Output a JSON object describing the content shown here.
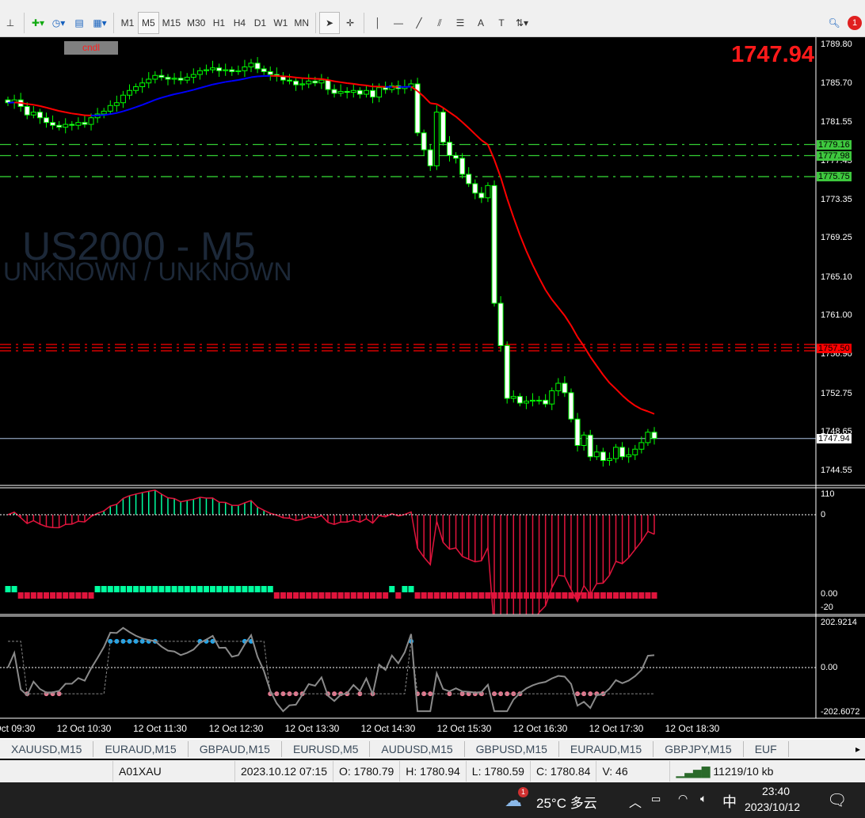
{
  "toolbar": {
    "timeframes": [
      "M1",
      "M5",
      "M15",
      "M30",
      "H1",
      "H4",
      "D1",
      "W1",
      "MN"
    ],
    "active_timeframe": "M5",
    "notification_count": "1"
  },
  "chart": {
    "symbol_watermark": "US2000 - M5",
    "subtitle_watermark": "UNKNOWN / UNKNOWN",
    "indicator_button": "cndl",
    "current_price": "1747.94",
    "colors": {
      "bull": "#00ff00",
      "bear_fill": "#ffffff",
      "ma_up": "#0000ff",
      "ma_down": "#ff0000",
      "level_green": "#32cd32",
      "level_red": "#ff0000"
    },
    "price_axis": [
      "1789.80",
      "1785.70",
      "1781.55",
      "1777.45",
      "1773.35",
      "1769.25",
      "1765.10",
      "1761.00",
      "1756.90",
      "1752.75",
      "1748.65",
      "1744.55"
    ],
    "levels": [
      {
        "price": "1779.16",
        "color": "green"
      },
      {
        "price": "1777.98",
        "color": "green"
      },
      {
        "price": "1775.75",
        "color": "green"
      },
      {
        "price": "1757.50",
        "color": "red"
      },
      {
        "price": "1747.94",
        "color": "white"
      }
    ],
    "time_axis": [
      "12 Oct 09:30",
      "12 Oct 10:30",
      "12 Oct 11:30",
      "12 Oct 12:30",
      "12 Oct 13:30",
      "12 Oct 14:30",
      "12 Oct 15:30",
      "12 Oct 16:30",
      "12 Oct 17:30",
      "12 Oct 18:30"
    ],
    "closes": [
      1783.6,
      1783.9,
      1783.2,
      1782.3,
      1782.6,
      1782.0,
      1781.5,
      1781.2,
      1781.0,
      1781.3,
      1781.2,
      1781.5,
      1781.3,
      1782.0,
      1782.4,
      1782.7,
      1783.3,
      1783.6,
      1784.4,
      1784.9,
      1785.3,
      1785.7,
      1786.1,
      1786.5,
      1786.3,
      1786.1,
      1786.2,
      1786.0,
      1786.3,
      1786.6,
      1787.0,
      1787.1,
      1787.3,
      1787.0,
      1787.1,
      1786.9,
      1787.0,
      1787.4,
      1787.8,
      1787.2,
      1786.9,
      1786.6,
      1786.4,
      1786.0,
      1785.9,
      1785.5,
      1785.6,
      1785.9,
      1785.7,
      1786.0,
      1785.0,
      1784.6,
      1784.8,
      1784.7,
      1784.9,
      1784.5,
      1784.9,
      1784.2,
      1785.2,
      1785.0,
      1785.4,
      1785.1,
      1785.3,
      1785.6,
      1780.4,
      1778.6,
      1776.9,
      1782.6,
      1779.4,
      1778.0,
      1777.7,
      1776.0,
      1775.0,
      1774.0,
      1773.5,
      1774.8,
      1762.3,
      1757.8,
      1752.2,
      1752.4,
      1751.7,
      1751.9,
      1752.0,
      1752.0,
      1751.6,
      1753.0,
      1753.8,
      1752.8,
      1750.0,
      1747.2,
      1748.3,
      1746.0,
      1746.5,
      1745.6,
      1745.8,
      1747.0,
      1746.0,
      1746.2,
      1746.8,
      1747.5,
      1748.6,
      1747.94
    ]
  },
  "indicator1": {
    "axis": [
      "110",
      "0",
      "0.00",
      "-20"
    ]
  },
  "indicator2": {
    "axis": [
      "202.9214",
      "0.00",
      "-202.6072"
    ]
  },
  "tabs": [
    "XAUUSD,M15",
    "EURAUD,M15",
    "GBPAUD,M15",
    "EURUSD,M5",
    "AUDUSD,M15",
    "GBPUSD,M15",
    "EURAUD,M15",
    "GBPJPY,M15",
    "EUF"
  ],
  "status": {
    "profile": "A01XAU",
    "datetime": "2023.10.12 07:15",
    "open": "O: 1780.79",
    "high": "H: 1780.94",
    "low": "L: 1780.59",
    "close": "C: 1780.84",
    "volume": "V: 46",
    "traffic": "11219/10 kb"
  },
  "taskbar": {
    "weather": "25°C 多云",
    "weather_badge": "1",
    "ime": "中",
    "time": "23:40",
    "date": "2023/10/12"
  }
}
